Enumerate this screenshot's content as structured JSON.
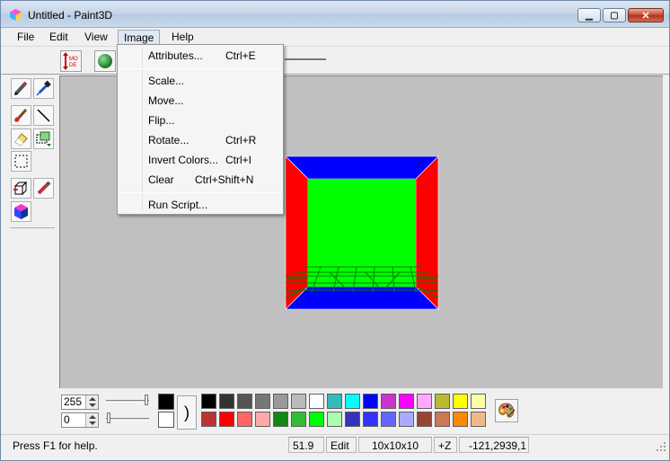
{
  "window": {
    "title": "Untitled - Paint3D",
    "controls": {
      "minimize": "minimize-icon",
      "maximize": "maximize-icon",
      "close": "close-icon"
    }
  },
  "menubar": {
    "items": [
      "File",
      "Edit",
      "View",
      "Image",
      "Help"
    ],
    "active": "Image"
  },
  "image_menu": {
    "groups": [
      [
        {
          "label": "Attributes...",
          "shortcut": "Ctrl+E"
        }
      ],
      [
        {
          "label": "Scale...",
          "shortcut": ""
        },
        {
          "label": "Move...",
          "shortcut": ""
        },
        {
          "label": "Flip...",
          "shortcut": ""
        },
        {
          "label": "Rotate...",
          "shortcut": "Ctrl+R"
        },
        {
          "label": "Invert Colors...",
          "shortcut": "Ctrl+I"
        },
        {
          "label": "Clear",
          "shortcut": "Ctrl+Shift+N"
        }
      ],
      [
        {
          "label": "Run Script...",
          "shortcut": ""
        }
      ]
    ]
  },
  "toolbar": {
    "buttons": [
      {
        "name": "mode",
        "icon": "mode-icon",
        "text": "MO DE"
      },
      {
        "name": "sphere",
        "icon": "sphere-icon"
      }
    ]
  },
  "tools": [
    "pencil-icon",
    "eyedropper-icon",
    "brush-icon",
    "line-icon",
    "eraser-icon",
    "select-move-icon",
    "marquee-icon",
    "extrude-icon",
    "paint-tube-icon",
    "color-cube-icon"
  ],
  "canvas": {
    "background": "#c0c0c0",
    "cube_colors": {
      "front": "#00ff00",
      "top": "#0000ff",
      "bottom": "#0000ff",
      "left": "#ff0000",
      "right": "#ff0000",
      "wire": "#008000"
    }
  },
  "bottom": {
    "spin1": "255",
    "spin2": "0",
    "foreground": "#000000",
    "background": "#ffffff",
    "palette_top": [
      "#000000",
      "#333333",
      "#555555",
      "#777777",
      "#999999",
      "#bbbbbb",
      "#ffffff",
      "#33bbbb",
      "#00ffff",
      "#0000ff",
      "#cc33cc",
      "#ff00ff",
      "#ffaaff",
      "#bbbb33",
      "#ffff00",
      "#ffffaa"
    ],
    "palette_bottom": [
      "#bb3333",
      "#ff0000",
      "#ff6666",
      "#ffaaaa",
      "#118811",
      "#33bb33",
      "#00ff00",
      "#aaffaa",
      "#3333bb",
      "#3333ff",
      "#6666ff",
      "#aaaaff",
      "#994433",
      "#cc7755",
      "#ff8800",
      "#eebb88"
    ],
    "palette_button_icon": "palette-icon"
  },
  "statusbar": {
    "help": "Press F1 for help.",
    "zoom": "51.9",
    "mode": "Edit",
    "size": "10x10x10",
    "axis": "+Z",
    "coords": "-121,2939,1"
  }
}
